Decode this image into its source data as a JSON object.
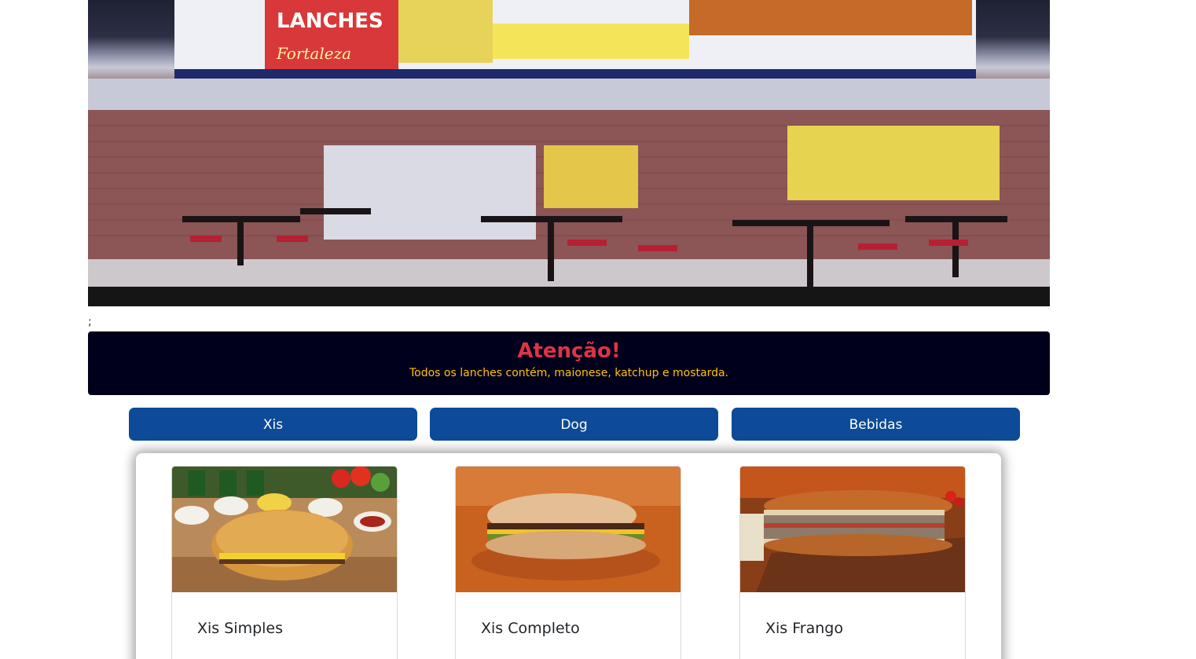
{
  "hero": {
    "sign_text": "LANCHES",
    "sign_subtext": "Fortaleza"
  },
  "stray_text": ";",
  "alert": {
    "title": "Atenção!",
    "text": "Todos os lanches contém, maionese, katchup e mostarda."
  },
  "categories": [
    {
      "label": "Xis"
    },
    {
      "label": "Dog"
    },
    {
      "label": "Bebidas"
    }
  ],
  "products": [
    {
      "name": "Xis Simples"
    },
    {
      "name": "Xis Completo"
    },
    {
      "name": "Xis Frango"
    }
  ],
  "colors": {
    "alert_bg": "#00001c",
    "alert_title": "#dc3545",
    "alert_text": "#ffc107",
    "button_bg": "#0d4a97"
  }
}
